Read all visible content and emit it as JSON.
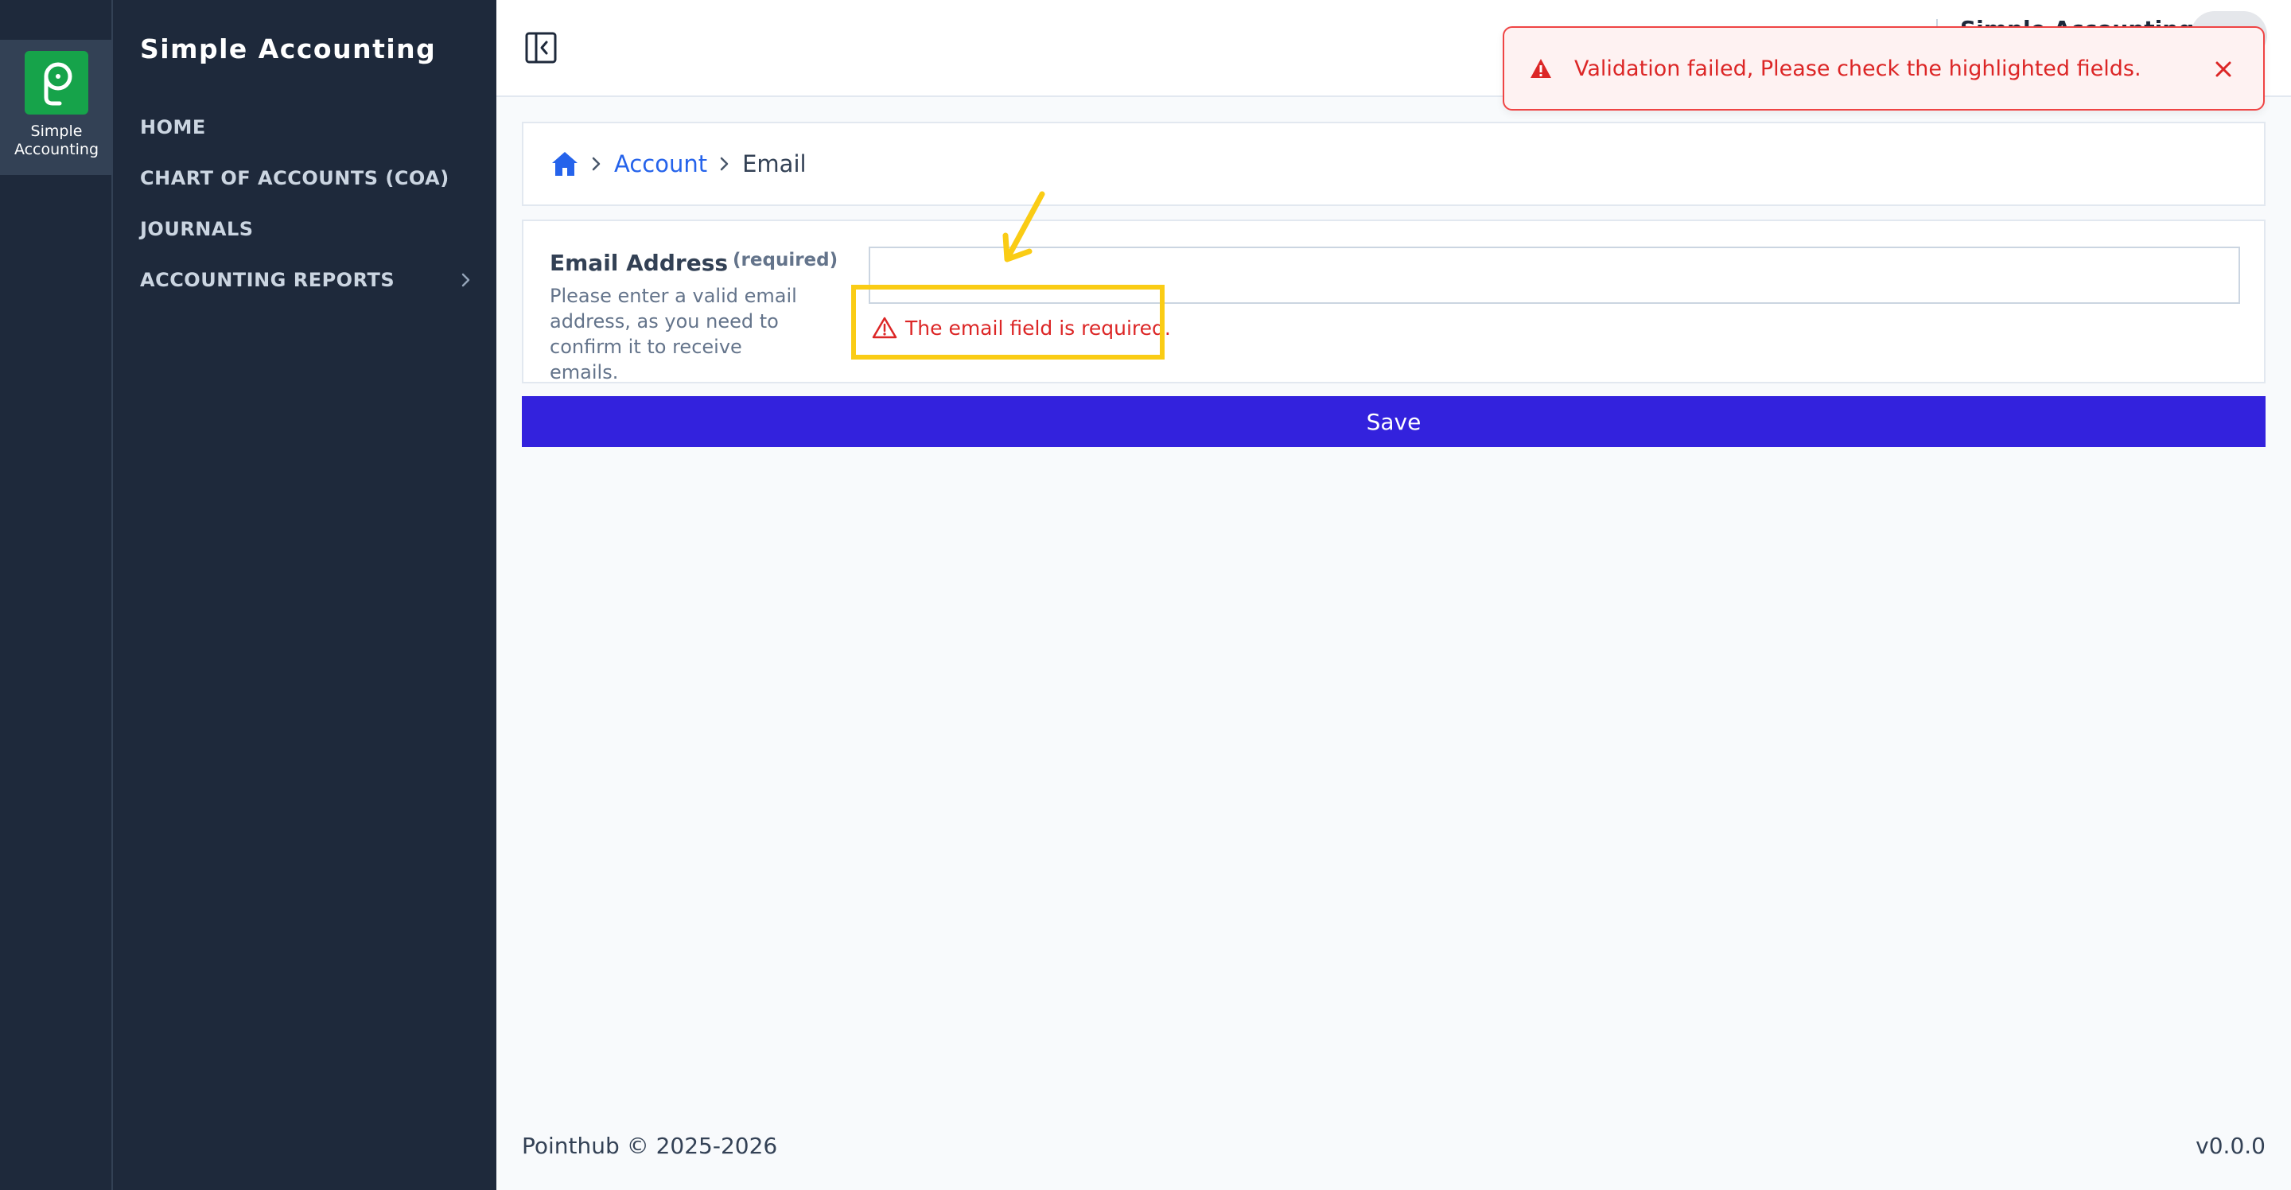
{
  "rail": {
    "app_label": "Simple Accounting",
    "logo_icon": "pointhub-logo-icon"
  },
  "sidebar": {
    "title": "Simple Accounting",
    "items": [
      {
        "label": "HOME"
      },
      {
        "label": "CHART OF ACCOUNTS (COA)"
      },
      {
        "label": "JOURNALS"
      },
      {
        "label": "ACCOUNTING REPORTS",
        "has_submenu": true
      }
    ]
  },
  "header": {
    "toggle_icon": "sidebar-toggle-icon",
    "org_name": "Simple Accounting"
  },
  "toast": {
    "message": "Validation failed, Please check the highlighted fields.",
    "icon": "warning-icon",
    "close_icon": "close-icon",
    "color": "#dc2626"
  },
  "breadcrumb": {
    "home_icon": "home-icon",
    "items": [
      {
        "label": "Account"
      },
      {
        "label": "Email"
      }
    ]
  },
  "form": {
    "email_label": "Email Address",
    "required_tag": "(required)",
    "help_text": "Please enter a valid email address, as you need to confirm it to receive emails.",
    "email_value": "",
    "error_message": "The email field is required."
  },
  "save_label": "Save",
  "footer": {
    "copyright": "Pointhub © 2025-2026",
    "version": "v0.0.0"
  },
  "colors": {
    "sidebar_bg": "#1e293b",
    "logo_green": "#16a34a",
    "save_button": "#3322dd",
    "error_red": "#dc2626",
    "annotation_yellow": "#facc15"
  }
}
